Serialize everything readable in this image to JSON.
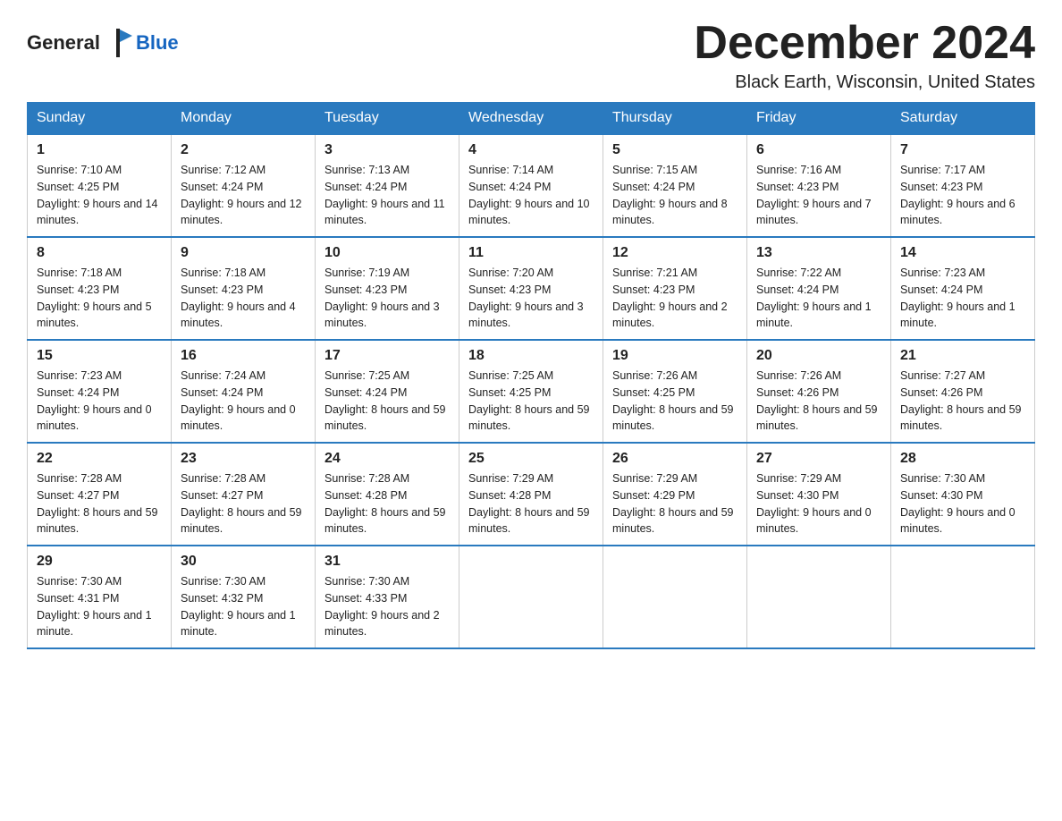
{
  "header": {
    "title": "December 2024",
    "location": "Black Earth, Wisconsin, United States"
  },
  "logo": {
    "general": "General",
    "blue": "Blue"
  },
  "days_of_week": [
    "Sunday",
    "Monday",
    "Tuesday",
    "Wednesday",
    "Thursday",
    "Friday",
    "Saturday"
  ],
  "weeks": [
    [
      {
        "day": "1",
        "sunrise": "Sunrise: 7:10 AM",
        "sunset": "Sunset: 4:25 PM",
        "daylight": "Daylight: 9 hours and 14 minutes."
      },
      {
        "day": "2",
        "sunrise": "Sunrise: 7:12 AM",
        "sunset": "Sunset: 4:24 PM",
        "daylight": "Daylight: 9 hours and 12 minutes."
      },
      {
        "day": "3",
        "sunrise": "Sunrise: 7:13 AM",
        "sunset": "Sunset: 4:24 PM",
        "daylight": "Daylight: 9 hours and 11 minutes."
      },
      {
        "day": "4",
        "sunrise": "Sunrise: 7:14 AM",
        "sunset": "Sunset: 4:24 PM",
        "daylight": "Daylight: 9 hours and 10 minutes."
      },
      {
        "day": "5",
        "sunrise": "Sunrise: 7:15 AM",
        "sunset": "Sunset: 4:24 PM",
        "daylight": "Daylight: 9 hours and 8 minutes."
      },
      {
        "day": "6",
        "sunrise": "Sunrise: 7:16 AM",
        "sunset": "Sunset: 4:23 PM",
        "daylight": "Daylight: 9 hours and 7 minutes."
      },
      {
        "day": "7",
        "sunrise": "Sunrise: 7:17 AM",
        "sunset": "Sunset: 4:23 PM",
        "daylight": "Daylight: 9 hours and 6 minutes."
      }
    ],
    [
      {
        "day": "8",
        "sunrise": "Sunrise: 7:18 AM",
        "sunset": "Sunset: 4:23 PM",
        "daylight": "Daylight: 9 hours and 5 minutes."
      },
      {
        "day": "9",
        "sunrise": "Sunrise: 7:18 AM",
        "sunset": "Sunset: 4:23 PM",
        "daylight": "Daylight: 9 hours and 4 minutes."
      },
      {
        "day": "10",
        "sunrise": "Sunrise: 7:19 AM",
        "sunset": "Sunset: 4:23 PM",
        "daylight": "Daylight: 9 hours and 3 minutes."
      },
      {
        "day": "11",
        "sunrise": "Sunrise: 7:20 AM",
        "sunset": "Sunset: 4:23 PM",
        "daylight": "Daylight: 9 hours and 3 minutes."
      },
      {
        "day": "12",
        "sunrise": "Sunrise: 7:21 AM",
        "sunset": "Sunset: 4:23 PM",
        "daylight": "Daylight: 9 hours and 2 minutes."
      },
      {
        "day": "13",
        "sunrise": "Sunrise: 7:22 AM",
        "sunset": "Sunset: 4:24 PM",
        "daylight": "Daylight: 9 hours and 1 minute."
      },
      {
        "day": "14",
        "sunrise": "Sunrise: 7:23 AM",
        "sunset": "Sunset: 4:24 PM",
        "daylight": "Daylight: 9 hours and 1 minute."
      }
    ],
    [
      {
        "day": "15",
        "sunrise": "Sunrise: 7:23 AM",
        "sunset": "Sunset: 4:24 PM",
        "daylight": "Daylight: 9 hours and 0 minutes."
      },
      {
        "day": "16",
        "sunrise": "Sunrise: 7:24 AM",
        "sunset": "Sunset: 4:24 PM",
        "daylight": "Daylight: 9 hours and 0 minutes."
      },
      {
        "day": "17",
        "sunrise": "Sunrise: 7:25 AM",
        "sunset": "Sunset: 4:24 PM",
        "daylight": "Daylight: 8 hours and 59 minutes."
      },
      {
        "day": "18",
        "sunrise": "Sunrise: 7:25 AM",
        "sunset": "Sunset: 4:25 PM",
        "daylight": "Daylight: 8 hours and 59 minutes."
      },
      {
        "day": "19",
        "sunrise": "Sunrise: 7:26 AM",
        "sunset": "Sunset: 4:25 PM",
        "daylight": "Daylight: 8 hours and 59 minutes."
      },
      {
        "day": "20",
        "sunrise": "Sunrise: 7:26 AM",
        "sunset": "Sunset: 4:26 PM",
        "daylight": "Daylight: 8 hours and 59 minutes."
      },
      {
        "day": "21",
        "sunrise": "Sunrise: 7:27 AM",
        "sunset": "Sunset: 4:26 PM",
        "daylight": "Daylight: 8 hours and 59 minutes."
      }
    ],
    [
      {
        "day": "22",
        "sunrise": "Sunrise: 7:28 AM",
        "sunset": "Sunset: 4:27 PM",
        "daylight": "Daylight: 8 hours and 59 minutes."
      },
      {
        "day": "23",
        "sunrise": "Sunrise: 7:28 AM",
        "sunset": "Sunset: 4:27 PM",
        "daylight": "Daylight: 8 hours and 59 minutes."
      },
      {
        "day": "24",
        "sunrise": "Sunrise: 7:28 AM",
        "sunset": "Sunset: 4:28 PM",
        "daylight": "Daylight: 8 hours and 59 minutes."
      },
      {
        "day": "25",
        "sunrise": "Sunrise: 7:29 AM",
        "sunset": "Sunset: 4:28 PM",
        "daylight": "Daylight: 8 hours and 59 minutes."
      },
      {
        "day": "26",
        "sunrise": "Sunrise: 7:29 AM",
        "sunset": "Sunset: 4:29 PM",
        "daylight": "Daylight: 8 hours and 59 minutes."
      },
      {
        "day": "27",
        "sunrise": "Sunrise: 7:29 AM",
        "sunset": "Sunset: 4:30 PM",
        "daylight": "Daylight: 9 hours and 0 minutes."
      },
      {
        "day": "28",
        "sunrise": "Sunrise: 7:30 AM",
        "sunset": "Sunset: 4:30 PM",
        "daylight": "Daylight: 9 hours and 0 minutes."
      }
    ],
    [
      {
        "day": "29",
        "sunrise": "Sunrise: 7:30 AM",
        "sunset": "Sunset: 4:31 PM",
        "daylight": "Daylight: 9 hours and 1 minute."
      },
      {
        "day": "30",
        "sunrise": "Sunrise: 7:30 AM",
        "sunset": "Sunset: 4:32 PM",
        "daylight": "Daylight: 9 hours and 1 minute."
      },
      {
        "day": "31",
        "sunrise": "Sunrise: 7:30 AM",
        "sunset": "Sunset: 4:33 PM",
        "daylight": "Daylight: 9 hours and 2 minutes."
      },
      null,
      null,
      null,
      null
    ]
  ]
}
